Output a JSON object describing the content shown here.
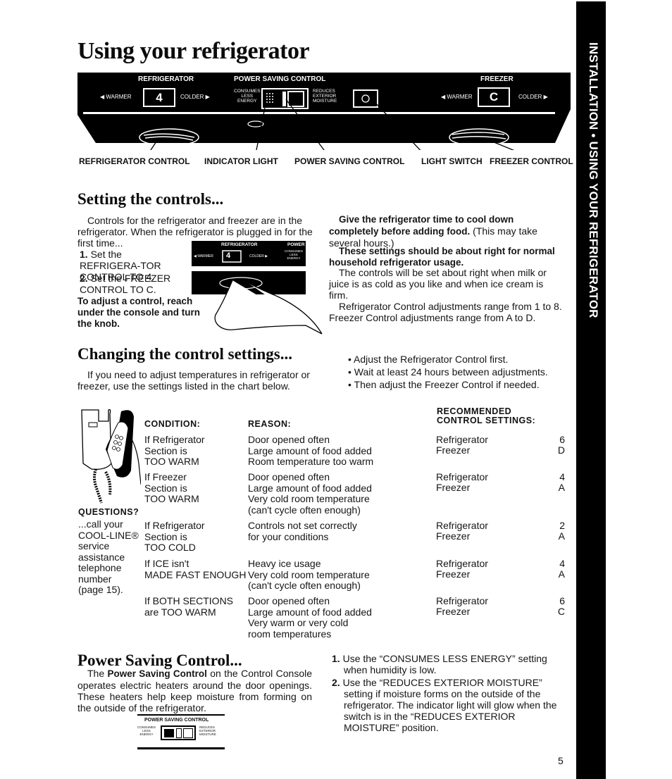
{
  "page": {
    "title": "Using your refrigerator",
    "side_tab": "INSTALLATION • USING YOUR REFRIGERATOR",
    "page_number": "5"
  },
  "console": {
    "refrigerator_label": "REFRIGERATOR",
    "refrigerator_value": "4",
    "warmer_label": "◀ WARMER",
    "colder_label": "COLDER ▶",
    "power_saving_label": "POWER SAVING CONTROL",
    "consumes_label": "CONSUMES\nLESS\nENERGY",
    "reduces_label": "REDUCES\nEXTERIOR\nMOISTURE",
    "freezer_label": "FREEZER",
    "freezer_value": "C",
    "callouts": [
      "REFRIGERATOR CONTROL",
      "INDICATOR LIGHT",
      "POWER SAVING CONTROL",
      "LIGHT SWITCH",
      "FREEZER CONTROL"
    ]
  },
  "setting_controls": {
    "heading": "Setting the controls...",
    "intro": "Controls for the refrigerator and freezer are in the refrigerator. When the refrigerator is plugged in for the first time...",
    "steps": [
      {
        "num": "1.",
        "text": "Set the REFRIGERA-TOR CONTROL TO 4."
      },
      {
        "num": "2.",
        "text": "Set the FREEZER CONTROL TO C."
      }
    ],
    "adjust_note": "To adjust a control, reach under the console and turn the knob.",
    "mini_console": {
      "refrigerator_label": "REFRIGERATOR",
      "value": "4",
      "warmer": "◀ WARMER",
      "colder": "COLDER ▶",
      "power": "POWER",
      "consumes": "CONSUMES\nLESS\nENERGY"
    },
    "right_col": {
      "cool_bold": "Give the refrigerator time to cool down completely before adding food.",
      "cool_rest": " (This may take several hours.)",
      "settings_bold": "These settings should be about right for normal household refrigerator usage.",
      "milk": "The controls will be set about right when milk or juice is as cold as you like and when ice cream is firm.",
      "range": "Refrigerator Control adjustments range from 1 to 8. Freezer Control adjustments range from A to D."
    }
  },
  "changing": {
    "heading": "Changing the control settings...",
    "intro": "If you need to adjust temperatures in refrigerator or freezer, use the settings listed in the chart below.",
    "bullets": [
      "Adjust the Refrigerator Control first.",
      "Wait at least 24 hours between adjustments.",
      "Then adjust the Freezer Control if needed."
    ]
  },
  "table": {
    "headers": {
      "condition": "CONDITION:",
      "reason": "REASON:",
      "recommended": "RECOMMENDED\nCONTROL SETTINGS:"
    },
    "rows": [
      {
        "condition": "If Refrigerator\nSection is\nTOO WARM",
        "reason": "Door opened often\nLarge amount of food added\nRoom temperature too warm",
        "refrigerator": "6",
        "freezer": "D"
      },
      {
        "condition": "If Freezer\nSection is\nTOO WARM",
        "reason": "Door opened often\nLarge amount of food added\nVery cold room temperature\n(can't cycle often enough)",
        "refrigerator": "4",
        "freezer": "A"
      },
      {
        "condition": "If Refrigerator\nSection is\nTOO COLD",
        "reason": "Controls not set correctly\nfor your conditions",
        "refrigerator": "2",
        "freezer": "A"
      },
      {
        "condition": "If ICE isn't\nMADE FAST ENOUGH",
        "reason": "Heavy ice usage\nVery cold room temperature\n(can't cycle often enough)",
        "refrigerator": "4",
        "freezer": "A"
      },
      {
        "condition": "If BOTH SECTIONS\nare TOO WARM",
        "reason": "Door opened often\nLarge amount of food added\nVery warm or very cold\nroom temperatures",
        "refrigerator": "6",
        "freezer": "C"
      }
    ],
    "setting_labels": {
      "refrigerator": "Refrigerator",
      "freezer": "Freezer"
    }
  },
  "questions": {
    "heading": "QUESTIONS?",
    "text": "...call your\nCOOL-LINE®\nservice\nassistance\ntelephone\nnumber\n(page 15)."
  },
  "power_saving": {
    "heading": "Power Saving Control...",
    "para_prefix": "The ",
    "para_bold": "Power Saving Control",
    "para_rest": " on the Control Console operates electric heaters around the door openings. These heaters help keep moisture from forming on the outside of the refrigerator.",
    "mini": {
      "label": "POWER SAVING CONTROL",
      "consumes": "CONSUMES\nLESS\nENERGY",
      "reduces": "REDUCES\nEXTERIOR\nMOISTURE"
    },
    "steps": [
      {
        "num": "1.",
        "text": "Use the “CONSUMES LESS ENERGY” setting when humidity is low."
      },
      {
        "num": "2.",
        "text": "Use the “REDUCES EXTERIOR MOISTURE” setting if moisture forms on the outside of the refrigerator. The indicator light will glow when the switch is in the “REDUCES EXTERIOR MOISTURE” position."
      }
    ]
  }
}
